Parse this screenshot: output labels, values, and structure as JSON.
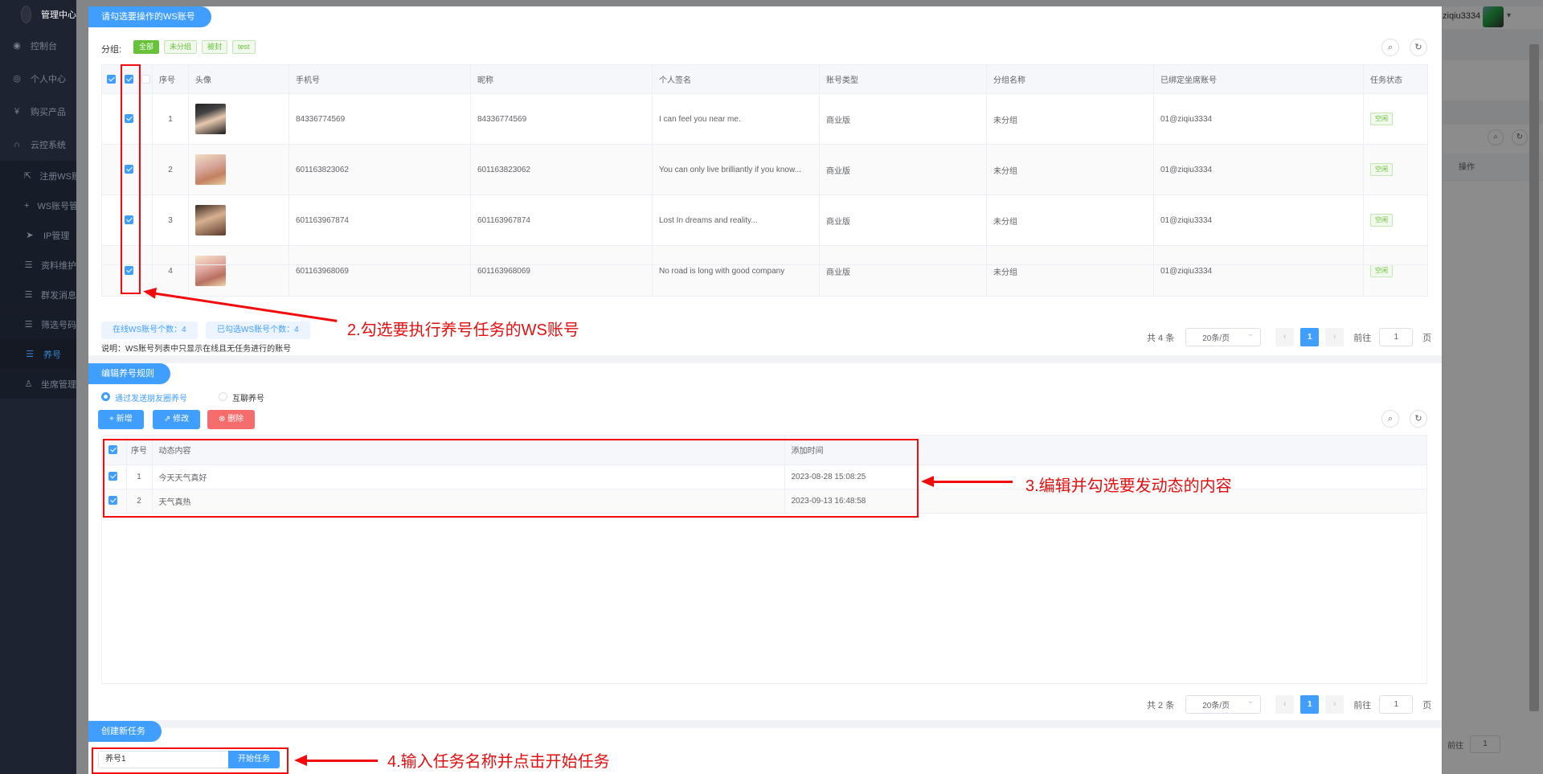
{
  "app": {
    "title": "管理中心",
    "username": "ziqiu3334"
  },
  "sidebar": {
    "items": [
      {
        "icon": "dashboard-icon",
        "glyph": "◉",
        "label": "控制台"
      },
      {
        "icon": "user-icon",
        "glyph": "◎",
        "label": "个人中心"
      },
      {
        "icon": "yen-icon",
        "glyph": "¥",
        "label": "购买产品"
      },
      {
        "icon": "headset-icon",
        "glyph": "∩",
        "label": "云控系统"
      }
    ],
    "subitems": [
      {
        "icon": "external-link-icon",
        "glyph": "⇱",
        "label": "注册WS账号"
      },
      {
        "icon": "plus-icon",
        "glyph": "+",
        "label": "WS账号管理"
      },
      {
        "icon": "send-icon",
        "glyph": "➤",
        "label": "IP管理"
      },
      {
        "icon": "list-icon",
        "glyph": "☰",
        "label": "资料维护"
      },
      {
        "icon": "list-icon",
        "glyph": "☰",
        "label": "群发消息"
      },
      {
        "icon": "list-icon",
        "glyph": "☰",
        "label": "筛选号码"
      },
      {
        "icon": "list-icon",
        "glyph": "☰",
        "label": "养号",
        "active": true
      },
      {
        "icon": "person-icon",
        "glyph": "♙",
        "label": "坐席管理"
      }
    ]
  },
  "background": {
    "operation_header": "操作",
    "goto_label": "前往",
    "goto_value": "1"
  },
  "accounts_section": {
    "tab_label": "请勾选要操作的WS账号",
    "group_label": "分组:",
    "group_tags": [
      {
        "label": "全部",
        "active": true
      },
      {
        "label": "未分组",
        "active": false
      },
      {
        "label": "被封",
        "active": false
      },
      {
        "label": "test",
        "active": false
      }
    ],
    "columns": [
      "序号",
      "头像",
      "手机号",
      "昵称",
      "个人签名",
      "账号类型",
      "分组名称",
      "已绑定坐席账号",
      "任务状态"
    ],
    "rows": [
      {
        "index": "1",
        "phone": "84336774569",
        "nickname": "84336774569",
        "signature": "I can feel you near me.",
        "type": "商业版",
        "group": "未分组",
        "seat": "01@ziqiu3334",
        "status": "空闲",
        "checked": true
      },
      {
        "index": "2",
        "phone": "601163823062",
        "nickname": "601163823062",
        "signature": "You can only live brilliantly if you know...",
        "type": "商业版",
        "group": "未分组",
        "seat": "01@ziqiu3334",
        "status": "空闲",
        "checked": true
      },
      {
        "index": "3",
        "phone": "601163967874",
        "nickname": "601163967874",
        "signature": "Lost In dreams and reality...",
        "type": "商业版",
        "group": "未分组",
        "seat": "01@ziqiu3334",
        "status": "空闲",
        "checked": true
      },
      {
        "index": "4",
        "phone": "601163968069",
        "nickname": "601163968069",
        "signature": "No road is long with good company",
        "type": "商业版",
        "group": "未分组",
        "seat": "01@ziqiu3334",
        "status": "空闲",
        "checked": true
      }
    ],
    "online_count_label": "在线WS账号个数：4",
    "selected_count_label": "已勾选WS账号个数：4",
    "note": "说明：WS账号列表中只显示在线且无任务进行的账号",
    "pagination": {
      "total": "共 4 条",
      "page_size": "20条/页",
      "current_page": "1",
      "goto_label": "前往",
      "goto_value": "1",
      "page_suffix": "页"
    }
  },
  "rules_section": {
    "tab_label": "编辑养号规则",
    "radio_options": [
      {
        "label": "通过发送朋友圈养号",
        "selected": true
      },
      {
        "label": "互聊养号",
        "selected": false
      }
    ],
    "buttons": {
      "add": "+ 新增",
      "edit": "⇗ 修改",
      "delete": "⊗ 删除"
    },
    "columns": [
      "序号",
      "动态内容",
      "添加时间"
    ],
    "rows": [
      {
        "index": "1",
        "content": "今天天气真好",
        "time": "2023-08-28 15:08:25",
        "checked": true
      },
      {
        "index": "2",
        "content": "天气真热",
        "time": "2023-09-13 16:48:58",
        "checked": true
      }
    ],
    "pagination": {
      "total": "共 2 条",
      "page_size": "20条/页",
      "current_page": "1",
      "goto_label": "前往",
      "goto_value": "1",
      "page_suffix": "页"
    }
  },
  "task_section": {
    "tab_label": "创建新任务",
    "task_name_value": "养号1",
    "start_button": "开始任务"
  },
  "annotations": {
    "step2": "2.勾选要执行养号任务的WS账号",
    "step3": "3.编辑并勾选要发动态的内容",
    "step4": "4.输入任务名称并点击开始任务"
  },
  "colors": {
    "primary": "#409eff",
    "success": "#67c23a",
    "danger": "#f56c6c",
    "annotation": "#e01010",
    "sidebar_bg": "#1d2330"
  }
}
